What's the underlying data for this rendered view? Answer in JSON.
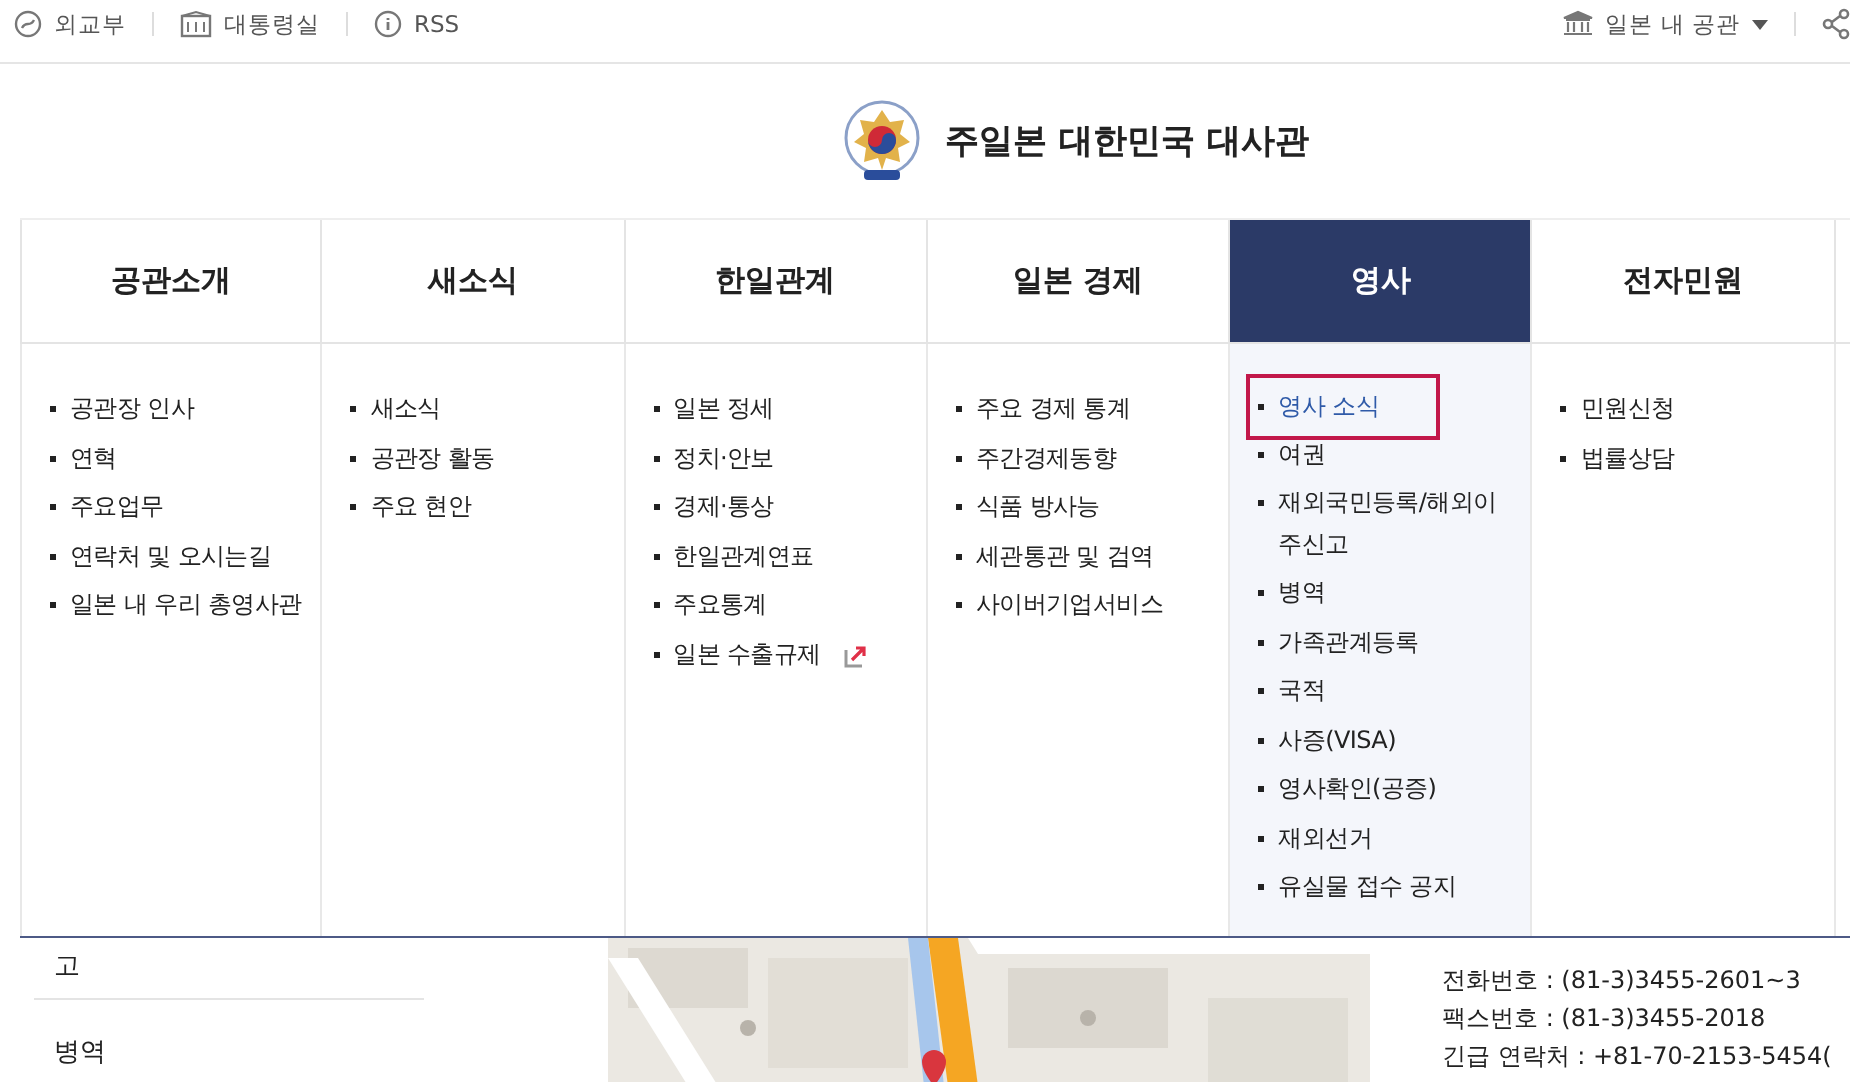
{
  "top_links": [
    {
      "label": "외교부"
    },
    {
      "label": "대통령실"
    },
    {
      "label": "RSS"
    }
  ],
  "mission_select": {
    "label": "일본 내 공관"
  },
  "site_title": "주일본 대한민국 대사관",
  "menus": [
    {
      "label": "공관소개",
      "selected": false,
      "items": [
        {
          "label": "공관장 인사",
          "selected": false,
          "external": false
        },
        {
          "label": "연혁",
          "selected": false,
          "external": false
        },
        {
          "label": "주요업무",
          "selected": false,
          "external": false
        },
        {
          "label": "연락처 및 오시는길",
          "selected": false,
          "external": false
        },
        {
          "label": "일본 내 우리 총영사관",
          "selected": false,
          "external": false
        }
      ]
    },
    {
      "label": "새소식",
      "selected": false,
      "items": [
        {
          "label": "새소식",
          "selected": false,
          "external": false
        },
        {
          "label": "공관장 활동",
          "selected": false,
          "external": false
        },
        {
          "label": "주요 현안",
          "selected": false,
          "external": false
        }
      ]
    },
    {
      "label": "한일관계",
      "selected": false,
      "items": [
        {
          "label": "일본 정세",
          "selected": false,
          "external": false
        },
        {
          "label": "정치·안보",
          "selected": false,
          "external": false
        },
        {
          "label": "경제·통상",
          "selected": false,
          "external": false
        },
        {
          "label": "한일관계연표",
          "selected": false,
          "external": false
        },
        {
          "label": "주요통계",
          "selected": false,
          "external": false
        },
        {
          "label": "일본 수출규제",
          "selected": false,
          "external": true
        }
      ]
    },
    {
      "label": "일본 경제",
      "selected": false,
      "items": [
        {
          "label": "주요 경제 통계",
          "selected": false,
          "external": false
        },
        {
          "label": "주간경제동향",
          "selected": false,
          "external": false
        },
        {
          "label": "식품 방사능",
          "selected": false,
          "external": false
        },
        {
          "label": "세관통관 및 검역",
          "selected": false,
          "external": false
        },
        {
          "label": "사이버기업서비스",
          "selected": false,
          "external": false
        }
      ]
    },
    {
      "label": "영사",
      "selected": true,
      "items": [
        {
          "label": "영사 소식",
          "selected": true,
          "external": false
        },
        {
          "label": "여권",
          "selected": false,
          "external": false
        },
        {
          "label": "재외국민등록/해외이주신고",
          "selected": false,
          "external": false
        },
        {
          "label": "병역",
          "selected": false,
          "external": false
        },
        {
          "label": "가족관계등록",
          "selected": false,
          "external": false
        },
        {
          "label": "국적",
          "selected": false,
          "external": false
        },
        {
          "label": "사증(VISA)",
          "selected": false,
          "external": false
        },
        {
          "label": "영사확인(공증)",
          "selected": false,
          "external": false
        },
        {
          "label": "재외선거",
          "selected": false,
          "external": false
        },
        {
          "label": "유실물 접수 공지",
          "selected": false,
          "external": false
        }
      ]
    },
    {
      "label": "전자민원",
      "selected": false,
      "items": [
        {
          "label": "민원신청",
          "selected": false,
          "external": false
        },
        {
          "label": "법률상담",
          "selected": false,
          "external": false
        }
      ]
    }
  ],
  "side_menu": [
    "고",
    "병역"
  ],
  "contact": [
    "전화번호 : (81-3)3455-2601~3",
    "팩스번호 : (81-3)3455-2018",
    "긴급 연락처 : +81-70-2153-5454("
  ]
}
